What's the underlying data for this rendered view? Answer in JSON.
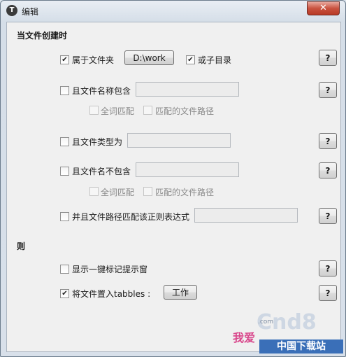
{
  "window": {
    "title": "编辑",
    "close_label": "✕",
    "app_icon_glyph": "T"
  },
  "section_when": "当文件创建时",
  "section_then": "则",
  "rows": {
    "in_folder": {
      "label": "属于文件夹",
      "checked": true,
      "folder_button": "D:\\work",
      "subfolders_label": "或子目录",
      "subfolders_checked": true
    },
    "name_contains": {
      "label": "且文件名称包含",
      "checked": false,
      "value": "",
      "whole_word": "全词匹配",
      "match_path": "匹配的文件路径"
    },
    "type_is": {
      "label": "且文件类型为",
      "checked": false,
      "value": ""
    },
    "name_not_contains": {
      "label": "且文件名不包含",
      "checked": false,
      "value": "",
      "whole_word": "全词匹配",
      "match_path": "匹配的文件路径"
    },
    "regex": {
      "label": "并且文件路径匹配该正则表达式",
      "checked": false,
      "value": ""
    },
    "show_popup": {
      "label": "显示一键标记提示窗",
      "checked": false
    },
    "tag_with": {
      "label": "将文件置入tabbles :",
      "checked": true,
      "tag_button": "工作"
    }
  },
  "help_label": "?",
  "watermark": {
    "brand": "Cnd8",
    "domain": ".com",
    "cn1": "我爱",
    "cn2": "中国下载站"
  }
}
